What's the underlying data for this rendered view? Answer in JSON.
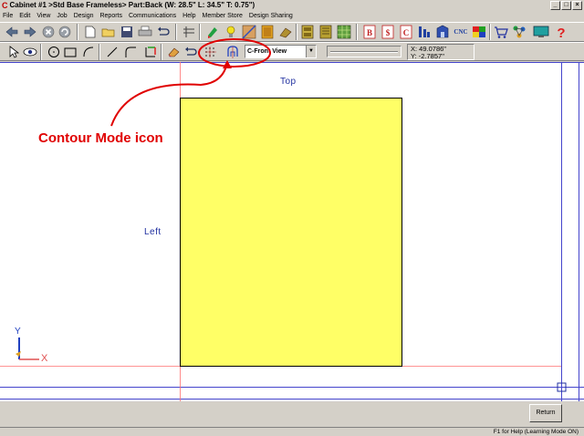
{
  "window": {
    "title": "Cabinet #1 >Std Base Frameless> Part:Back (W: 28.5\" L: 34.5\" T: 0.75\")",
    "app_icon": "C",
    "minimize_glyph": "_",
    "maximize_glyph": "□",
    "close_glyph": "×"
  },
  "menu": {
    "items": [
      {
        "label": "File"
      },
      {
        "label": "Edit"
      },
      {
        "label": "View"
      },
      {
        "label": "Job"
      },
      {
        "label": "Design"
      },
      {
        "label": "Reports"
      },
      {
        "label": "Communications"
      },
      {
        "label": "Help"
      },
      {
        "label": "Member Store"
      },
      {
        "label": "Design Sharing"
      }
    ]
  },
  "toolbar1": {
    "cnc_label": "CNC"
  },
  "toolbar2": {
    "view_select": {
      "value": "C-Front View"
    },
    "coords": {
      "x": "X: 49.0786\"",
      "y": "Y: -2.7857\""
    }
  },
  "canvas": {
    "label_top": "Top",
    "label_left": "Left",
    "annotation": "Contour Mode icon",
    "axis_y": "Y",
    "axis_x": "X",
    "part_color": "#ffff66",
    "annotation_color": "#e00000",
    "guide_color": "#4444cc"
  },
  "bottom": {
    "return_label": "Return"
  },
  "status": {
    "text": "F1 for Help (Learning Mode ON)"
  }
}
